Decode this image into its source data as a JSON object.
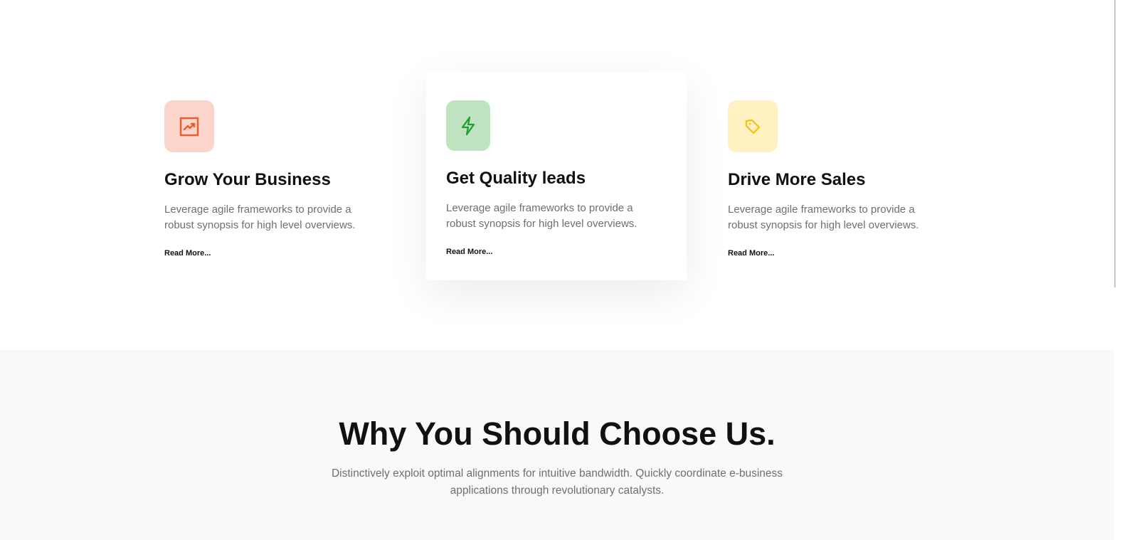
{
  "features": {
    "cards": [
      {
        "icon": "trending-up-icon",
        "icon_bg": "#fbd5cb",
        "icon_color": "#f15a29",
        "title": "Grow Your Business",
        "description": "Leverage agile frameworks to provide a robust synopsis for high level overviews.",
        "link": "Read More..."
      },
      {
        "icon": "lightning-icon",
        "icon_bg": "#bfe3c0",
        "icon_color": "#1f9e32",
        "title": "Get Quality leads",
        "description": "Leverage agile frameworks to provide a robust synopsis for high level overviews.",
        "link": "Read More...",
        "highlighted": true
      },
      {
        "icon": "tag-icon",
        "icon_bg": "#fff1c2",
        "icon_color": "#f5c400",
        "title": "Drive More Sales",
        "description": "Leverage agile frameworks to provide a robust synopsis for high level overviews.",
        "link": "Read More..."
      }
    ]
  },
  "why": {
    "title": "Why You Should Choose Us.",
    "description": "Distinctively exploit optimal alignments for intuitive bandwidth. Quickly coordinate e-business applications through revolutionary catalysts."
  },
  "colors": {
    "heading": "#111111",
    "body_text": "#6f6f6f",
    "section_bg": "#f9f9f9"
  }
}
